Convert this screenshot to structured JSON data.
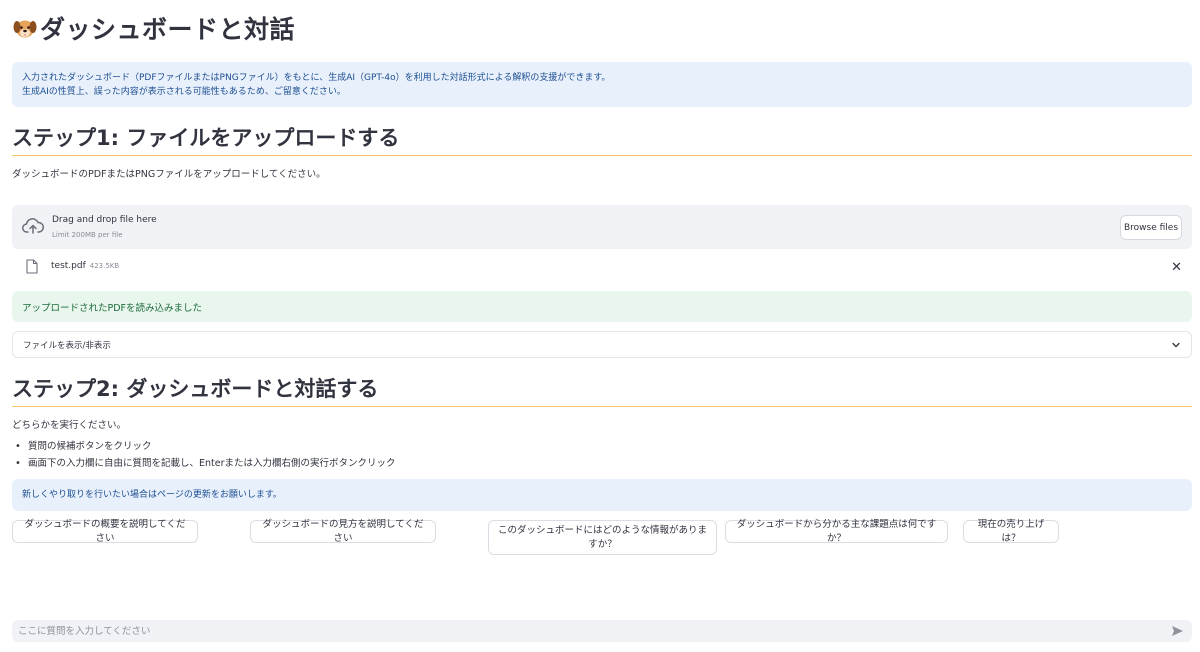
{
  "header": {
    "title": "ダッシュボードと対話",
    "title_icon": "dog-face-icon"
  },
  "intro": {
    "line1": "入力されたダッシュボード（PDFファイルまたはPNGファイル）をもとに、生成AI（GPT-4o）を利用した対話形式による解釈の支援ができます。",
    "line2": "生成AIの性質上、誤った内容が表示される可能性もあるため、ご留意ください。"
  },
  "step1": {
    "heading": "ステップ1: ファイルをアップロードする",
    "instruction": "ダッシュボードのPDFまたはPNGファイルをアップロードしてください。",
    "uploader": {
      "drop_text": "Drag and drop file here",
      "limit_text": "Limit 200MB per file",
      "browse_label": "Browse files"
    },
    "file": {
      "name": "test.pdf",
      "size": "423.5KB"
    },
    "success_message": "アップロードされたPDFを読み込みました",
    "expander_label": "ファイルを表示/非表示"
  },
  "step2": {
    "heading": "ステップ2: ダッシュボードと対話する",
    "instruction": "どちらかを実行ください。",
    "bullets": [
      "質問の候補ボタンをクリック",
      "画面下の入力欄に自由に質問を記載し、Enterまたは入力欄右側の実行ボタンクリック"
    ],
    "refresh_note": "新しくやり取りを行いたい場合はページの更新をお願いします。",
    "suggestions": [
      "ダッシュボードの概要を説明してください",
      "ダッシュボードの見方を説明してください",
      "このダッシュボードにはどのような情報がありますか？",
      "ダッシュボードから分かる主な課題点は何ですか？",
      "現在の売り上げは？"
    ]
  },
  "chat": {
    "placeholder": "ここに質問を入力してください"
  },
  "colors": {
    "info_bg": "#e8f0fc",
    "info_text": "#1d4f91",
    "success_bg": "#e9f6ee",
    "success_text": "#1c6b3a",
    "heading_rule": "#f6c76a",
    "input_bg": "#f0f2f6"
  }
}
